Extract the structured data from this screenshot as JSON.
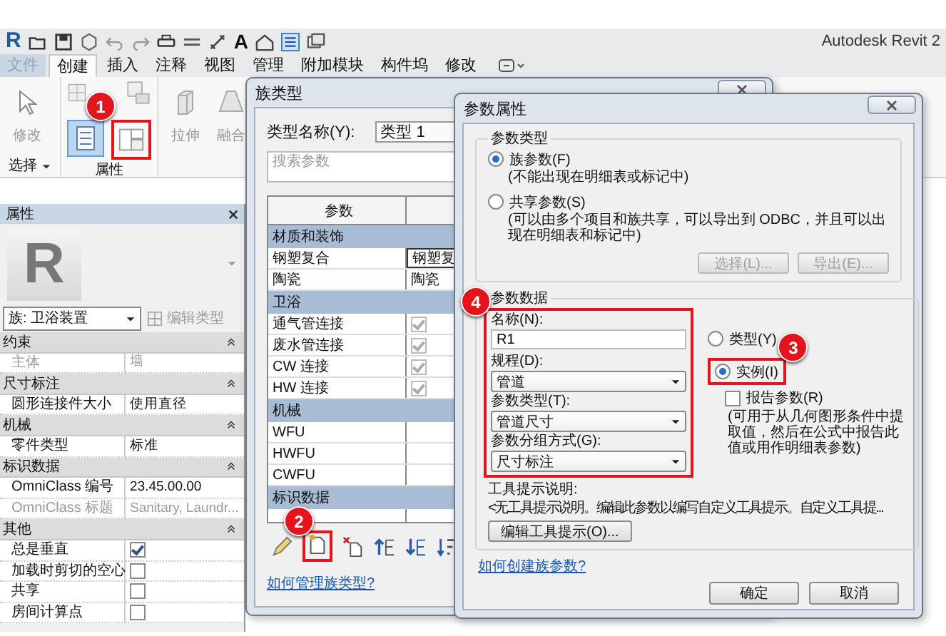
{
  "app": {
    "logo": "R",
    "text_tool": "A",
    "title": "Autodesk Revit 2",
    "tabs": [
      {
        "label": "文件",
        "kind": "file",
        "selected": false
      },
      {
        "label": "创建",
        "kind": "tab",
        "selected": true
      },
      {
        "label": "插入",
        "kind": "tab",
        "selected": false
      },
      {
        "label": "注释",
        "kind": "tab",
        "selected": false
      },
      {
        "label": "视图",
        "kind": "tab",
        "selected": false
      },
      {
        "label": "管理",
        "kind": "tab",
        "selected": false
      },
      {
        "label": "附加模块",
        "kind": "tab",
        "selected": false
      },
      {
        "label": "构件坞",
        "kind": "tab",
        "selected": false
      },
      {
        "label": "修改",
        "kind": "tab",
        "selected": false
      }
    ]
  },
  "ribbon": {
    "panels": [
      {
        "label": "选择",
        "dropdown": true,
        "tools": [
          {
            "kind": "modify",
            "label": "修改",
            "disabled": true
          }
        ]
      },
      {
        "label": "属性",
        "dropdown": false,
        "tools": [
          {
            "kind": "family-types",
            "selected": true
          },
          {
            "kind": "type-properties",
            "selected": false
          }
        ]
      },
      {
        "tools": [
          {
            "kind": "extrusion",
            "label": "拉伸",
            "disabled": true
          },
          {
            "kind": "blend",
            "label": "融合",
            "disabled": true
          }
        ]
      }
    ]
  },
  "properties_panel": {
    "title": "属性",
    "preview_logo": "R",
    "family_selector": "族: 卫浴装置",
    "edit_type_button": {
      "label": "编辑类型",
      "disabled": true
    },
    "groups": [
      {
        "name": "约束",
        "rows": [
          {
            "label": "主体",
            "kind": "text",
            "value": "墙",
            "disabled": true
          }
        ]
      },
      {
        "name": "尺寸标注",
        "rows": [
          {
            "label": "圆形连接件大小",
            "kind": "text",
            "value": "使用直径",
            "disabled": false
          }
        ]
      },
      {
        "name": "机械",
        "rows": [
          {
            "label": "零件类型",
            "kind": "text",
            "value": "标准",
            "disabled": false
          }
        ]
      },
      {
        "name": "标识数据",
        "rows": [
          {
            "label": "OmniClass 编号",
            "kind": "text",
            "value": "23.45.00.00",
            "disabled": false
          },
          {
            "label": "OmniClass 标题",
            "kind": "text",
            "value": "Sanitary, Laundr...",
            "disabled": true
          }
        ]
      },
      {
        "name": "其他",
        "rows": [
          {
            "label": "总是垂直",
            "kind": "checkbox",
            "checked": true,
            "disabled": false
          },
          {
            "label": "加载时剪切的空心",
            "kind": "checkbox",
            "checked": false,
            "disabled": false
          },
          {
            "label": "共享",
            "kind": "checkbox",
            "checked": false,
            "disabled": false
          },
          {
            "label": "房间计算点",
            "kind": "checkbox",
            "checked": false,
            "disabled": false
          }
        ]
      }
    ]
  },
  "family_types_dialog": {
    "title": "族类型",
    "type_name_label": "类型名称(Y):",
    "type_name": "类型 1",
    "search": {
      "placeholder": "搜索参数"
    },
    "column": "参数",
    "groups": [
      {
        "name": "材质和装饰",
        "rows": [
          {
            "label": "钢塑复合",
            "kind": "text",
            "value": "钢塑复"
          },
          {
            "label": "陶瓷",
            "kind": "text",
            "value": "陶瓷"
          }
        ]
      },
      {
        "name": "卫浴",
        "rows": [
          {
            "label": "通气管连接",
            "kind": "checkbox",
            "checked": true
          },
          {
            "label": "废水管连接",
            "kind": "checkbox",
            "checked": true
          },
          {
            "label": "CW 连接",
            "kind": "checkbox",
            "checked": true
          },
          {
            "label": "HW 连接",
            "kind": "checkbox",
            "checked": true
          }
        ]
      },
      {
        "name": "机械",
        "rows": [
          {
            "label": "WFU",
            "kind": "text"
          },
          {
            "label": "HWFU",
            "kind": "text"
          },
          {
            "label": "CWFU",
            "kind": "text"
          }
        ]
      },
      {
        "name": "标识数据"
      }
    ],
    "help_link": "如何管理族类型?"
  },
  "parameter_dialog": {
    "title": "参数属性",
    "parameter_type": {
      "title": "参数类型",
      "options": [
        {
          "label": "族参数(F)",
          "note": "(不能出现在明细表或标记中)",
          "selected": true
        },
        {
          "label": "共享参数(S)",
          "note": "(可以由多个项目和族共享，可以导出到 ODBC，并且可以出现在明细表和标记中)",
          "selected": false
        }
      ],
      "buttons": [
        {
          "label": "选择(L)...",
          "disabled": true
        },
        {
          "label": "导出(E)...",
          "disabled": true
        }
      ]
    },
    "parameter_data": {
      "title": "参数数据",
      "name_label": "名称(N):",
      "name": "R1",
      "fields": [
        {
          "label": "规程(D):",
          "value": "管道"
        },
        {
          "label": "参数类型(T):",
          "value": "管道尺寸"
        },
        {
          "label": "参数分组方式(G):",
          "value": "尺寸标注"
        }
      ],
      "scope": [
        {
          "label": "类型(Y)",
          "selected": false
        },
        {
          "label": "实例(I)",
          "selected": true
        }
      ],
      "report": {
        "label": "报告参数(R)",
        "checked": false,
        "note": "(可用于从几何图形条件中提取值，然后在公式中报告此值或用作明细表参数)"
      },
      "tooltip_label": "工具提示说明:",
      "tooltip": "<无工具提示说明。编辑此参数以编写自定义工具提示。自定义工具提...",
      "tooltip_button": "编辑工具提示(O)..."
    },
    "help_link": "如何创建族参数?",
    "buttons": [
      "确定",
      "取消"
    ]
  },
  "annotations": [
    {
      "number": "1"
    },
    {
      "number": "2"
    },
    {
      "number": "3"
    },
    {
      "number": "4"
    }
  ]
}
